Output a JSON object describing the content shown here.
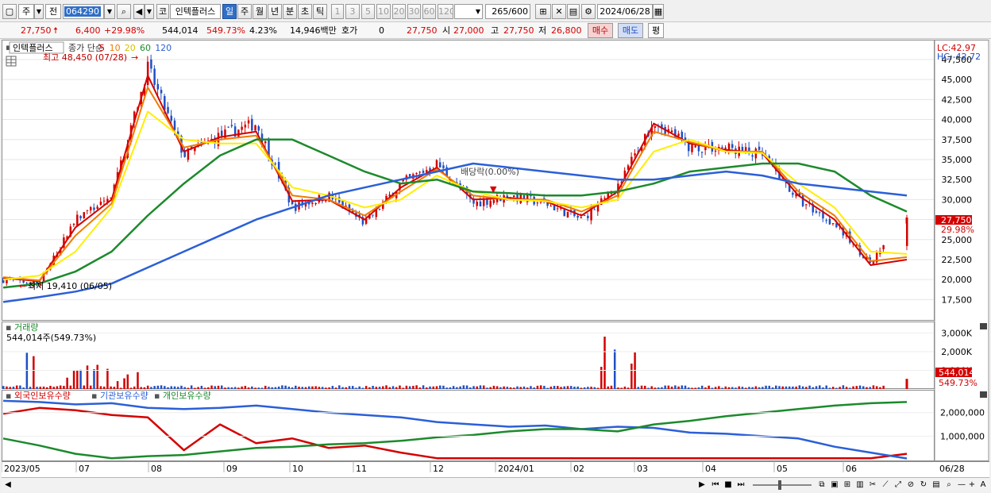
{
  "toolbar": {
    "type_label": "주",
    "prev_label": "전",
    "code_value": "064290",
    "market_label": "코",
    "stock_name": "인텍플러스",
    "periods": [
      "일",
      "주",
      "월",
      "년",
      "분",
      "초",
      "틱"
    ],
    "selected_period": "일",
    "intervals": [
      "1",
      "3",
      "5",
      "10",
      "20",
      "30",
      "60",
      "120"
    ],
    "count_value": "265",
    "count_total": "/600",
    "date_value": "2024/06/28"
  },
  "infobar": {
    "price": "27,750",
    "change": "6,400",
    "change_pct": "+29.98%",
    "volume": "544,014",
    "volume_pct": "549.73%",
    "turnover": "4.23%",
    "amount": "14,946백만",
    "quote_label": "호가",
    "quote_value": "0",
    "quote_price": "27,750",
    "open_label": "시",
    "open_value": "27,000",
    "high_label": "고",
    "high_value": "27,750",
    "low_label": "저",
    "low_value": "26,800",
    "buy_label": "매수",
    "sell_label": "매도",
    "avg_label": "평"
  },
  "colors": {
    "up": "#d40000",
    "down": "#1f4fc4",
    "ma5": "#d40000",
    "ma10": "#f07b00",
    "ma20": "#ffee00",
    "ma60": "#1c8a2c",
    "ma120": "#2b5fd8"
  },
  "price_panel": {
    "stock_label": "인텍플러스",
    "legend": [
      {
        "text": "종가 단순",
        "color": "#333333"
      },
      {
        "text": "5",
        "color": "#d40000"
      },
      {
        "text": "10",
        "color": "#f07b00"
      },
      {
        "text": "20",
        "color": "#d4c000"
      },
      {
        "text": "60",
        "color": "#1c8a2c"
      },
      {
        "text": "120",
        "color": "#2b5fd8"
      }
    ],
    "high_note": "최고 48,450 (07/28)",
    "low_note": "최저 19,410 (06/05)",
    "dividend_note": "배당락(0.00%)",
    "lc_label": "LC:42.97",
    "hc_label": "HC:-42.72",
    "last_price_tag": "27,750",
    "last_pct_tag": "29.98%",
    "y_ticks": [
      "47,500",
      "45,000",
      "42,500",
      "40,000",
      "37,500",
      "35,000",
      "32,500",
      "30,000",
      "27,500",
      "25,000",
      "22,500",
      "20,000",
      "17,500"
    ]
  },
  "volume_panel": {
    "title": "거래량",
    "summary": "544,014주(549.73%)",
    "y_ticks": [
      "3,000K",
      "2,000K",
      "1,000K"
    ],
    "last_tag": "544,014",
    "last_pct_tag": "549.73%"
  },
  "holdings_panel": {
    "legend": [
      {
        "text": "외국인보유수량",
        "color": "#d40000"
      },
      {
        "text": "기관보유수량",
        "color": "#2b5fd8"
      },
      {
        "text": "개인보유수량",
        "color": "#1c8a2c"
      }
    ],
    "y_ticks": [
      "2,000,000",
      "1,000,000"
    ]
  },
  "x_axis": [
    "2023/05",
    "07",
    "08",
    "09",
    "10",
    "11",
    "12",
    "2024/01",
    "02",
    "03",
    "04",
    "05",
    "06",
    "06/28"
  ],
  "chart_data": [
    {
      "type": "candlestick",
      "title": "인텍플러스",
      "x_range": [
        "2023/05",
        "2024/06/28"
      ],
      "ylim": [
        16000,
        48500
      ],
      "y_ticks": [
        17500,
        20000,
        22500,
        25000,
        27500,
        30000,
        32500,
        35000,
        37500,
        40000,
        42500,
        45000,
        47500
      ],
      "annotations": {
        "high": {
          "value": 48450,
          "date": "07/28"
        },
        "low": {
          "value": 19410,
          "date": "06/05"
        }
      },
      "last": {
        "date": "2024/06/28",
        "open": 27000,
        "high": 27750,
        "low": 26800,
        "close": 27750
      },
      "close_series": {
        "x": [
          "2023/05",
          "2023/06",
          "2023/07",
          "2023/07",
          "2023/08",
          "2023/08",
          "2023/09",
          "2023/09",
          "2023/10",
          "2023/10",
          "2023/11",
          "2023/11",
          "2023/12",
          "2023/12",
          "2024/01",
          "2024/01",
          "2024/02",
          "2024/02",
          "2024/03",
          "2024/03",
          "2024/04",
          "2024/04",
          "2024/05",
          "2024/05",
          "2024/06",
          "2024/06/28"
        ],
        "values": [
          20000,
          19500,
          27500,
          30500,
          46500,
          35500,
          38000,
          39500,
          29000,
          30500,
          27000,
          32000,
          34500,
          29500,
          30500,
          29500,
          27500,
          31500,
          40000,
          36500,
          36500,
          35500,
          30000,
          27000,
          22000,
          27750
        ]
      },
      "ma": [
        {
          "name": "5",
          "values": [
            20200,
            19800,
            26500,
            30000,
            45500,
            36000,
            37800,
            38500,
            29800,
            30000,
            27500,
            31500,
            34000,
            30000,
            30200,
            29800,
            28000,
            31000,
            39500,
            37000,
            36200,
            35800,
            30500,
            27500,
            21800,
            22500
          ]
        },
        {
          "name": "10",
          "values": [
            20300,
            19900,
            25500,
            29500,
            44000,
            36500,
            37500,
            38000,
            30500,
            30000,
            28000,
            31000,
            33800,
            30500,
            30000,
            30000,
            28500,
            30500,
            38500,
            37200,
            36000,
            36000,
            31000,
            28000,
            22300,
            22800
          ]
        },
        {
          "name": "20",
          "values": [
            20000,
            20500,
            23500,
            29000,
            41000,
            37500,
            37000,
            37000,
            31500,
            30500,
            29000,
            30000,
            33000,
            31000,
            30000,
            29800,
            29000,
            30000,
            36000,
            37500,
            36000,
            35800,
            32000,
            29000,
            23500,
            23200
          ]
        },
        {
          "name": "60",
          "values": [
            19000,
            19500,
            21000,
            23500,
            28000,
            32000,
            35500,
            37500,
            37500,
            35500,
            33500,
            32000,
            32500,
            31000,
            30800,
            30500,
            30500,
            31000,
            32000,
            33500,
            34000,
            34500,
            34500,
            33500,
            30500,
            28500
          ]
        },
        {
          "name": "120",
          "values": [
            17200,
            17800,
            18500,
            19500,
            21500,
            23500,
            25500,
            27500,
            29000,
            30500,
            31500,
            32500,
            33500,
            34500,
            34000,
            33500,
            33000,
            32500,
            32500,
            33000,
            33500,
            33000,
            32000,
            31500,
            31000,
            30500
          ]
        }
      ]
    },
    {
      "type": "bar",
      "title": "거래량",
      "ylim": [
        0,
        3400000
      ],
      "y_ticks": [
        1000000,
        2000000,
        3000000
      ],
      "last": {
        "date": "2024/06/28",
        "value": 544014,
        "pct": 549.73
      }
    },
    {
      "type": "line",
      "ylim": [
        0,
        2700000
      ],
      "y_ticks": [
        1000000,
        2000000
      ],
      "series": [
        {
          "name": "외국인보유수량",
          "values": [
            1950000,
            2200000,
            2100000,
            1900000,
            1800000,
            400000,
            1500000,
            700000,
            900000,
            500000,
            600000,
            300000,
            60000,
            60000,
            60000,
            60000,
            60000,
            60000,
            60000,
            60000,
            60000,
            60000,
            60000,
            60000,
            60000,
            250000
          ]
        },
        {
          "name": "기관보유수량",
          "values": [
            2500000,
            2450000,
            2350000,
            2400000,
            2200000,
            2150000,
            2200000,
            2300000,
            2150000,
            2000000,
            1900000,
            1800000,
            1600000,
            1500000,
            1400000,
            1450000,
            1300000,
            1400000,
            1350000,
            1150000,
            1100000,
            1000000,
            900000,
            550000,
            300000,
            50000
          ]
        },
        {
          "name": "개인보유수량",
          "values": [
            900000,
            600000,
            250000,
            60000,
            150000,
            200000,
            350000,
            500000,
            550000,
            650000,
            700000,
            800000,
            950000,
            1050000,
            1200000,
            1300000,
            1300000,
            1200000,
            1500000,
            1650000,
            1850000,
            2000000,
            2150000,
            2300000,
            2400000,
            2450000
          ]
        }
      ]
    }
  ]
}
